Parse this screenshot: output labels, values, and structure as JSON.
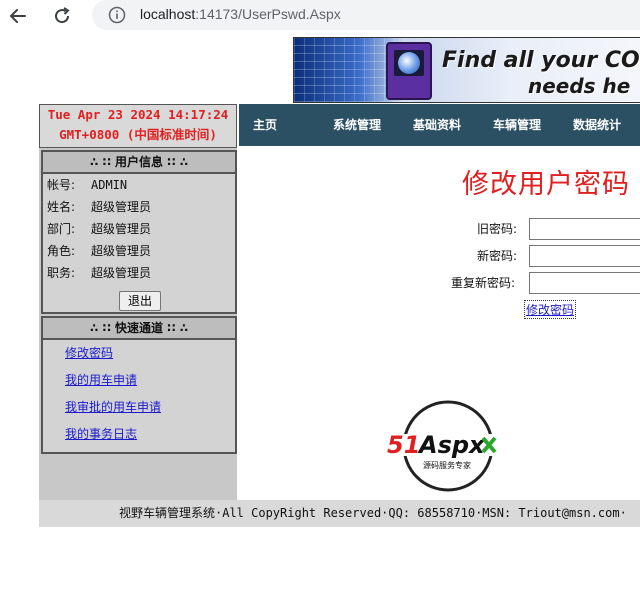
{
  "browser": {
    "url_host": "localhost",
    "url_rest": ":14173/UserPswd.Aspx"
  },
  "banner": {
    "line1": "Find all your CO",
    "line2": "needs he"
  },
  "clock": {
    "line1": "Tue Apr 23 2024 14:17:24",
    "line2": "GMT+0800 (中国标准时间)"
  },
  "nav": {
    "items": [
      "主页",
      "系统管理",
      "基础资料",
      "车辆管理",
      "数据统计"
    ]
  },
  "user_info": {
    "title": "∴ ∷ 用户信息 ∷ ∴",
    "rows": [
      {
        "label": "帐号:",
        "value": "ADMIN"
      },
      {
        "label": "姓名:",
        "value": "超级管理员"
      },
      {
        "label": "部门:",
        "value": "超级管理员"
      },
      {
        "label": "角色:",
        "value": "超级管理员"
      },
      {
        "label": "职务:",
        "value": "超级管理员"
      }
    ],
    "logout_label": "退出"
  },
  "quick": {
    "title": "∴ ∷ 快速通道 ∷ ∴",
    "links": [
      "修改密码",
      "我的用车申请",
      "我审批的用车申请",
      "我的事务日志"
    ]
  },
  "form": {
    "title": "修改用户密码",
    "old_label": "旧密码:",
    "new_label": "新密码:",
    "repeat_label": "重复新密码:",
    "old_value": "",
    "new_value": "",
    "repeat_value": "",
    "submit_label": "修改密码"
  },
  "logo": {
    "brand": "51Aspx",
    "tagline": "源码服务专家"
  },
  "footer": {
    "text": "视野车辆管理系统·All CopyRight Reserved·QQ: 68558710·MSN: Triout@msn.com·"
  },
  "colors": {
    "nav_bg": "#2b4f63",
    "title_red": "#e02020",
    "link_blue": "#1a1acc"
  }
}
